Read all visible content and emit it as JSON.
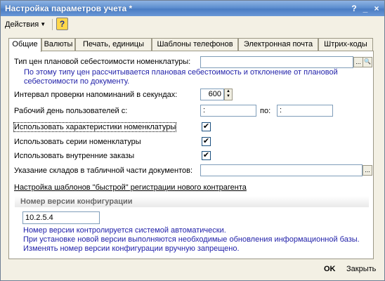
{
  "window": {
    "title": "Настройка параметров учета *"
  },
  "titlebar_buttons": {
    "help": "?",
    "minimize": "_",
    "close": "×"
  },
  "toolbar": {
    "actions_label": "Действия",
    "help_label": "?"
  },
  "tabs": [
    {
      "label": "Общие",
      "active": true
    },
    {
      "label": "Валюты"
    },
    {
      "label": "Печать, единицы"
    },
    {
      "label": "Шаблоны телефонов"
    },
    {
      "label": "Электронная почта"
    },
    {
      "label": "Штрих-коды"
    }
  ],
  "form": {
    "price_type": {
      "label": "Тип цен плановой себестоимости номенклатуры:",
      "value": "",
      "hint_line1": "По этому типу цен рассчитывается плановая себестоимость и отклонение от плановой",
      "hint_line2": "себестоимости по документу."
    },
    "reminder_interval": {
      "label": "Интервал проверки напоминаний в секундах:",
      "value": "600"
    },
    "workday": {
      "label": "Рабочий день пользователей с:",
      "from": " :",
      "to_label": "по:",
      "to": " :"
    },
    "use_characteristics": {
      "label": "Использовать характеристики номенклатуры",
      "checked": true
    },
    "use_series": {
      "label": "Использовать серии номенклатуры",
      "checked": true
    },
    "use_internal_orders": {
      "label": "Использовать внутренние заказы",
      "checked": true
    },
    "warehouse_spec": {
      "label": "Указание складов в табличной части документов:",
      "value": ""
    },
    "quick_reg_link": "Настройка шаблонов \"быстрой\" регистрации нового контрагента"
  },
  "config_version": {
    "title": "Номер версии конфигурации",
    "value": "10.2.5.4",
    "note_line1": "Номер версии контролируется системой автоматически.",
    "note_line2": "При установке новой версии выполняются необходимые обновления информационной базы.",
    "note_line3": "Изменять номер версии конфигурации вручную запрещено."
  },
  "footer": {
    "ok_label": "OK",
    "close_label": "Закрыть"
  },
  "glyphs": {
    "ellipsis": "...",
    "magnifier": "🔍",
    "check": "✔",
    "spin_up": "▲",
    "spin_down": "▼",
    "dropdown": "▼"
  },
  "colors": {
    "hint_text": "#1f1fa8",
    "title_bar": "#5e8fd0",
    "window_bg": "#f3f0e4"
  }
}
